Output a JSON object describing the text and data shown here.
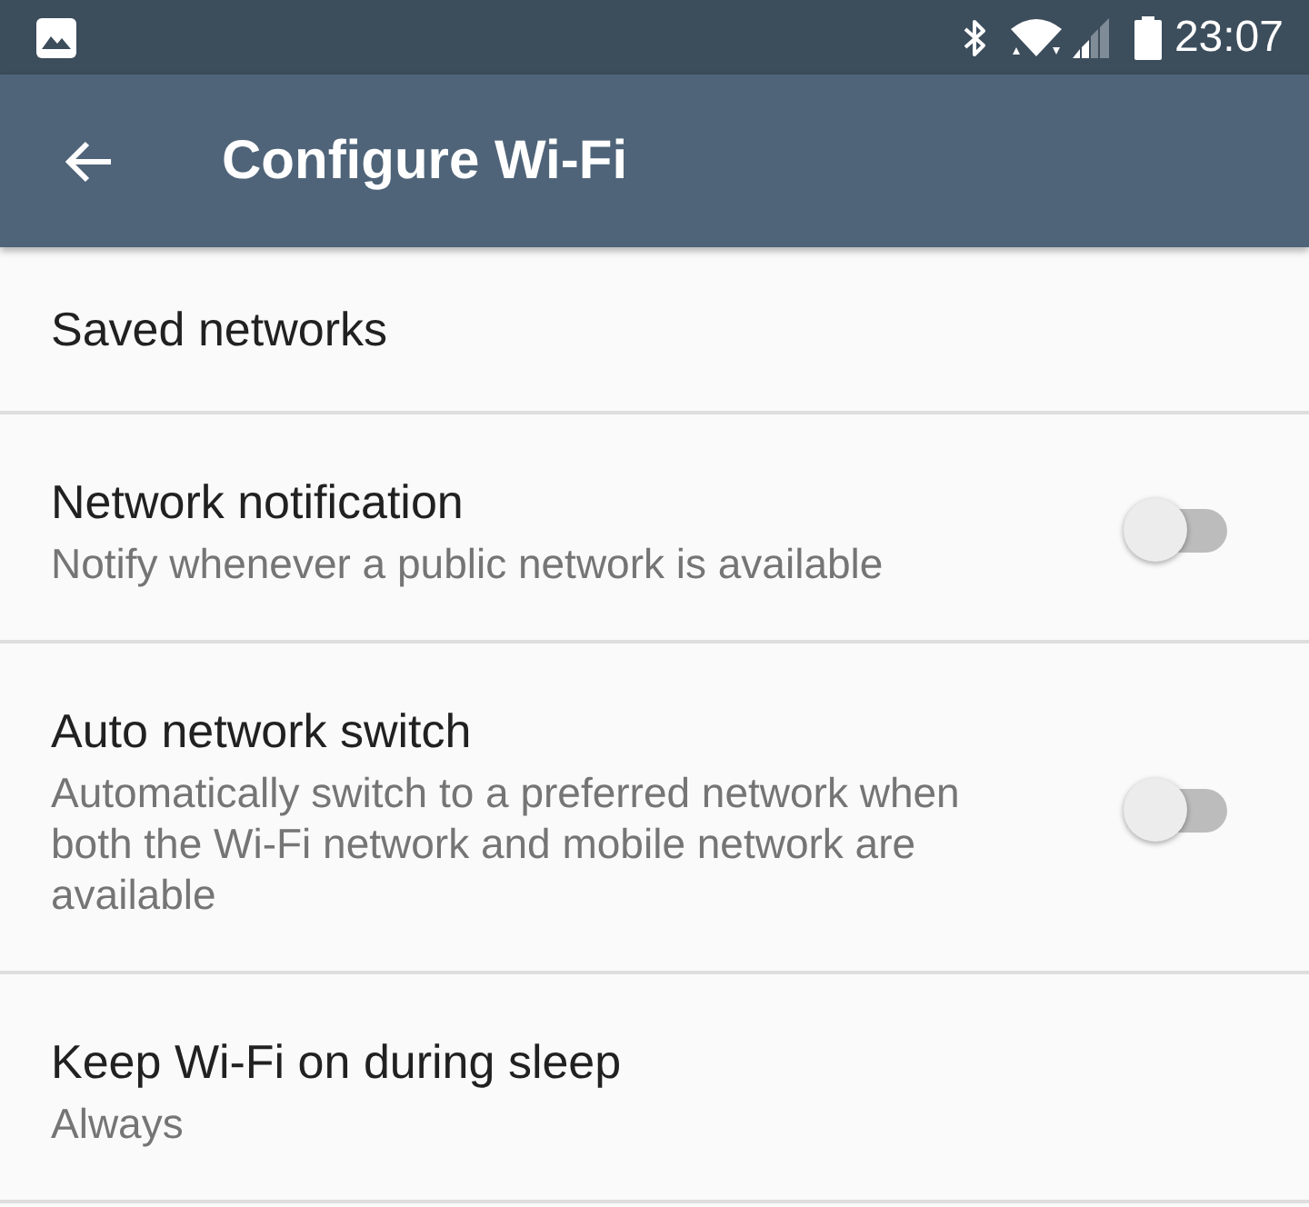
{
  "status_bar": {
    "time": "23:07"
  },
  "toolbar": {
    "title": "Configure Wi-Fi"
  },
  "settings": [
    {
      "kind": "link",
      "title": "Saved networks"
    },
    {
      "kind": "switch",
      "title": "Network notification",
      "summary": "Notify whenever a public network is available",
      "on": false
    },
    {
      "kind": "switch",
      "title": "Auto network switch",
      "summary": "Automatically switch to a preferred network when both the Wi-Fi network and mobile network are available",
      "on": false
    },
    {
      "kind": "link",
      "title": "Keep Wi-Fi on during sleep",
      "summary": "Always"
    }
  ]
}
